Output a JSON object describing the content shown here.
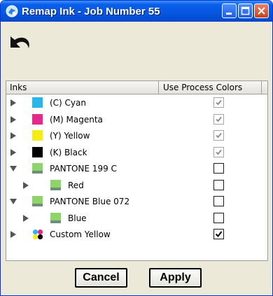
{
  "window": {
    "title": "Remap Ink - Job Number 55",
    "app_icon": "remap-app-icon",
    "controls": [
      "minimize-icon",
      "maximize-icon",
      "close-icon"
    ],
    "accent": "#0556e1"
  },
  "toolbar": {
    "undo_icon": "undo-arrow-icon"
  },
  "grid": {
    "columns": [
      "Inks",
      "Use Process Colors"
    ],
    "rows": [
      {
        "label": "(C) Cyan",
        "swatch": "#2bb6ea",
        "expander": "collapsed",
        "indent": 0,
        "use_process": "checked-disabled"
      },
      {
        "label": "(M) Magenta",
        "swatch": "#e5288c",
        "expander": "collapsed",
        "indent": 0,
        "use_process": "checked-disabled"
      },
      {
        "label": "(Y) Yellow",
        "swatch": "#f6ec14",
        "expander": "collapsed",
        "indent": 0,
        "use_process": "checked-disabled"
      },
      {
        "label": "(K) Black",
        "swatch": "#000000",
        "expander": "collapsed",
        "indent": 0,
        "use_process": "checked-disabled"
      },
      {
        "label": "PANTONE 199 C",
        "swatch": "#8fd46b",
        "expander": "expanded",
        "indent": 0,
        "use_process": "unchecked"
      },
      {
        "label": "Red",
        "swatch": "#8fd46b",
        "expander": "collapsed",
        "indent": 1,
        "use_process": "unchecked"
      },
      {
        "label": "PANTONE Blue 072",
        "swatch": "#8fd46b",
        "expander": "expanded",
        "indent": 0,
        "use_process": "unchecked"
      },
      {
        "label": "Blue",
        "swatch": "#8fd46b",
        "expander": "collapsed",
        "indent": 1,
        "use_process": "unchecked"
      },
      {
        "label": "Custom Yellow",
        "swatch": "cmyk-multicolor",
        "expander": "collapsed",
        "indent": 0,
        "use_process": "checked"
      }
    ]
  },
  "buttons": {
    "cancel": "Cancel",
    "apply": "Apply"
  }
}
